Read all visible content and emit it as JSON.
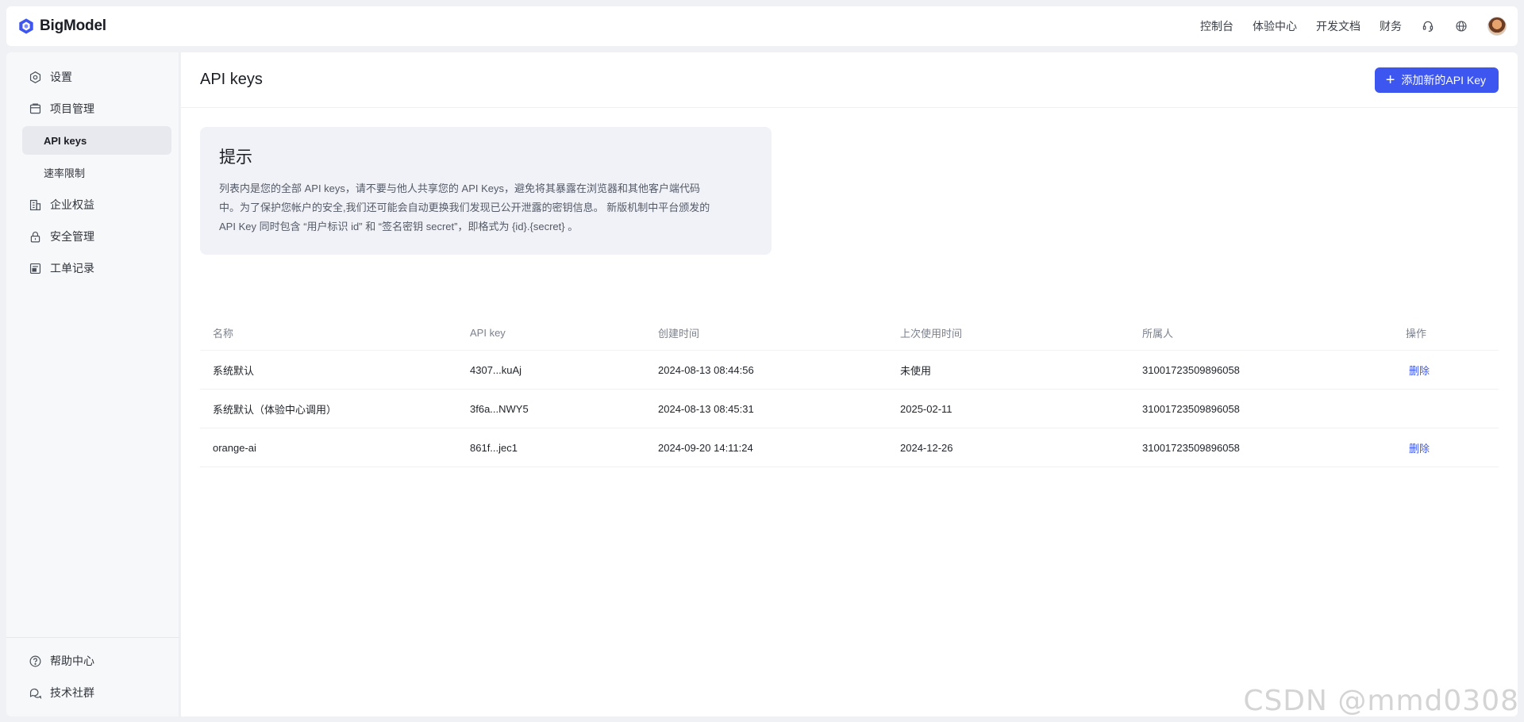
{
  "brand": {
    "name": "BigModel"
  },
  "topnav": {
    "links": [
      "控制台",
      "体验中心",
      "开发文档",
      "财务"
    ],
    "icons": [
      "headset-icon",
      "globe-icon"
    ]
  },
  "sidebar": {
    "items": [
      {
        "label": "设置",
        "icon": "settings-icon"
      },
      {
        "label": "项目管理",
        "icon": "project-icon"
      },
      {
        "label": "API keys",
        "sub": true,
        "active": true
      },
      {
        "label": "速率限制",
        "sub": true
      },
      {
        "label": "企业权益",
        "icon": "building-icon"
      },
      {
        "label": "安全管理",
        "icon": "lock-icon"
      },
      {
        "label": "工单记录",
        "icon": "ticket-icon"
      }
    ],
    "bottom": [
      {
        "label": "帮助中心",
        "icon": "help-icon"
      },
      {
        "label": "技术社群",
        "icon": "chat-icon"
      }
    ]
  },
  "main": {
    "title": "API keys",
    "add_button": "添加新的API Key",
    "tip": {
      "title": "提示",
      "line1": "列表内是您的全部 API keys，请不要与他人共享您的 API Keys，避免将其暴露在浏览器和其他客户端代码",
      "line2": "中。为了保护您帐户的安全,我们还可能会自动更换我们发现已公开泄露的密钥信息。 新版机制中平台颁发的",
      "line3": "API Key 同时包含 “用户标识 id” 和 “签名密钥 secret”，即格式为 {id}.{secret} 。"
    },
    "table": {
      "headers": [
        "名称",
        "API key",
        "创建时间",
        "上次使用时间",
        "所属人",
        "操作"
      ],
      "rows": [
        {
          "name": "系统默认",
          "key": "4307...kuAj",
          "created": "2024-08-13 08:44:56",
          "last_used": "未使用",
          "owner": "31001723509896058",
          "action": "删除"
        },
        {
          "name": "系统默认（体验中心调用）",
          "key": "3f6a...NWY5",
          "created": "2024-08-13 08:45:31",
          "last_used": "2025-02-11",
          "owner": "31001723509896058",
          "action": ""
        },
        {
          "name": "orange-ai",
          "key": "861f...jec1",
          "created": "2024-09-20 14:11:24",
          "last_used": "2024-12-26",
          "owner": "31001723509896058",
          "action": "删除"
        }
      ]
    }
  },
  "watermark": "CSDN @mmd0308",
  "colors": {
    "accent": "#3d56f0",
    "tip_bg": "#f1f2f8",
    "sidebar_bg": "#f7f8fa"
  }
}
